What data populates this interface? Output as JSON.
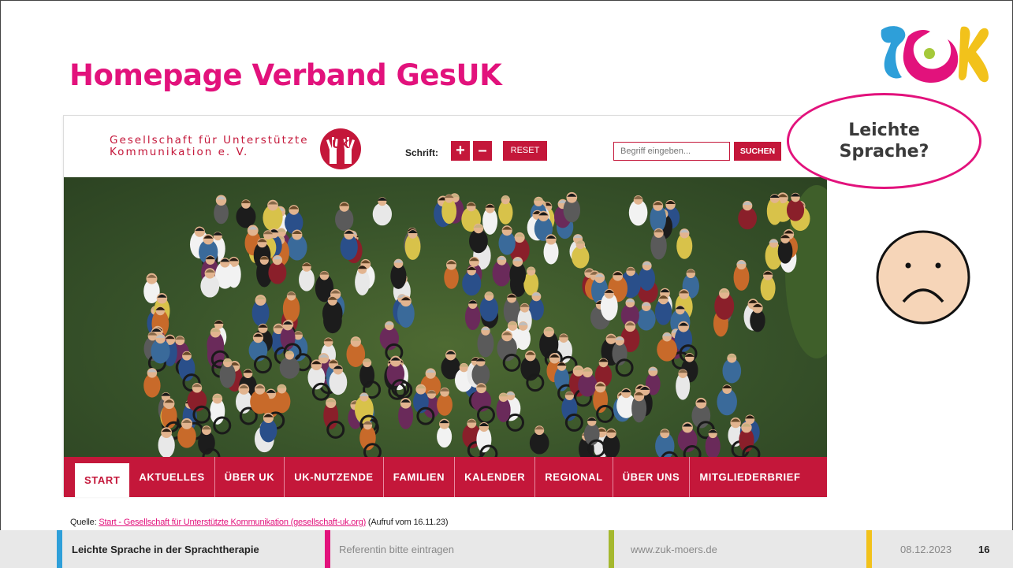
{
  "slide": {
    "title": "Homepage Verband GesUK",
    "bubble_text": "Leichte Sprache?",
    "source_prefix": "Quelle: ",
    "source_link": "Start - Gesellschaft für Unterstützte Kommunikation (gesellschaft-uk.org)",
    "source_suffix": " (Aufruf vom 16.11.23)"
  },
  "website": {
    "org_name_line1": "Gesellschaft für Unterstützte",
    "org_name_line2": "Kommunikation e. V.",
    "logo_text": "UK",
    "font_label": "Schrift:",
    "font_plus": "+",
    "font_minus": "–",
    "reset_label": "RESET",
    "search_placeholder": "Begriff eingeben...",
    "search_button": "SUCHEN",
    "nav": [
      {
        "label": "START"
      },
      {
        "label": "AKTUELLES"
      },
      {
        "label": "ÜBER UK"
      },
      {
        "label": "UK-NUTZENDE"
      },
      {
        "label": "FAMILIEN"
      },
      {
        "label": "KALENDER"
      },
      {
        "label": "REGIONAL"
      },
      {
        "label": "ÜBER UNS"
      },
      {
        "label": "MITGLIEDERBRIEF"
      }
    ],
    "active_nav": "START",
    "brand_color": "#c4173a"
  },
  "footer": {
    "title": "Leichte Sprache in der Sprachtherapie",
    "presenter": "Referentin bitte eintragen",
    "url": "www.zuk-moers.de",
    "date": "08.12.2023",
    "page": "16",
    "bar_colors": [
      "#2e9fd9",
      "#e2127c",
      "#a5b82e",
      "#f2c21b"
    ]
  },
  "colors": {
    "accent": "#e2127c",
    "logo_blue": "#2e9fd9",
    "logo_green": "#a5c93a",
    "logo_yellow": "#f2c21b",
    "face": "#f6d5b8"
  }
}
